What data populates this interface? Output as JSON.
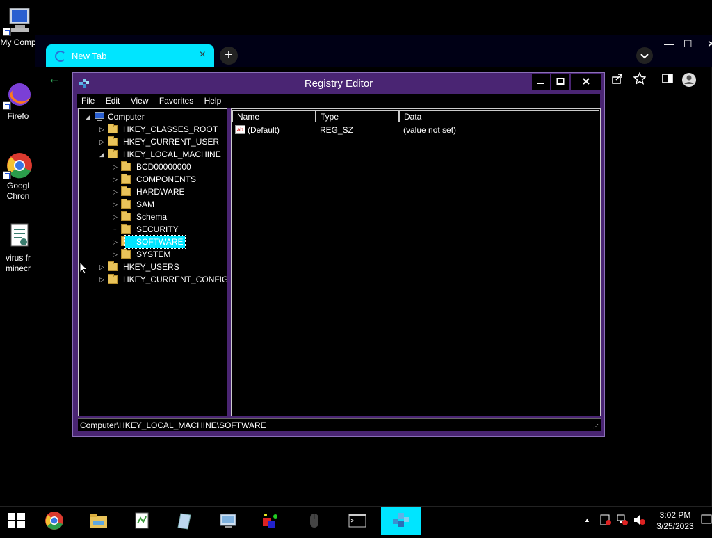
{
  "desktop": {
    "icons": [
      {
        "label": "My Comp"
      },
      {
        "label": "Firefo"
      },
      {
        "label_line1": "Googl",
        "label_line2": "Chron"
      },
      {
        "label_line1": "virus fr",
        "label_line2": "minecr"
      }
    ]
  },
  "browser": {
    "tab_title": "New Tab",
    "tab_close": "×",
    "new_tab": "+",
    "minimize": "—",
    "maximize": "☐",
    "close": "✕",
    "back": "←"
  },
  "regedit": {
    "title": "Registry Editor",
    "menu": [
      "File",
      "Edit",
      "View",
      "Favorites",
      "Help"
    ],
    "tree": {
      "root": "Computer",
      "hives": [
        "HKEY_CLASSES_ROOT",
        "HKEY_CURRENT_USER",
        "HKEY_LOCAL_MACHINE"
      ],
      "hklm_children": [
        "BCD00000000",
        "COMPONENTS",
        "HARDWARE",
        "SAM",
        "Schema",
        "SECURITY",
        "SOFTWARE",
        "SYSTEM"
      ],
      "hives_after": [
        "HKEY_USERS",
        "HKEY_CURRENT_CONFIG"
      ],
      "selected": "SOFTWARE"
    },
    "columns": {
      "name": "Name",
      "type": "Type",
      "data": "Data"
    },
    "values": [
      {
        "name": "(Default)",
        "type": "REG_SZ",
        "data": "(value not set)",
        "icon": "ab"
      }
    ],
    "status_path": "Computer\\HKEY_LOCAL_MACHINE\\SOFTWARE"
  },
  "taskbar": {
    "time": "3:02 PM",
    "date": "3/25/2023",
    "tray_up": "▲"
  },
  "colors": {
    "accent": "#00e5ff",
    "regedit_frame": "#4a2573",
    "folder": "#e9c35a"
  }
}
